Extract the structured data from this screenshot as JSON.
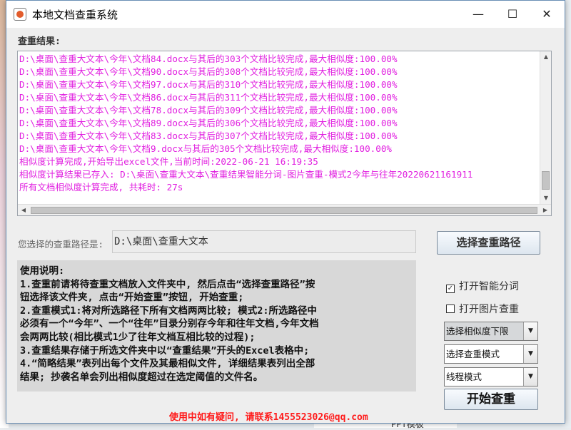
{
  "window": {
    "title": "本地文档查重系统",
    "minimize": "—",
    "maximize": "☐",
    "close": "✕"
  },
  "results": {
    "label": "查重结果:",
    "lines": [
      "D:\\桌面\\查重大文本\\今年\\文档84.docx与其后的303个文档比较完成,最大相似度:100.00%",
      "D:\\桌面\\查重大文本\\今年\\文档90.docx与其后的308个文档比较完成,最大相似度:100.00%",
      "D:\\桌面\\查重大文本\\今年\\文档97.docx与其后的310个文档比较完成,最大相似度:100.00%",
      "D:\\桌面\\查重大文本\\今年\\文档86.docx与其后的311个文档比较完成,最大相似度:100.00%",
      "D:\\桌面\\查重大文本\\今年\\文档78.docx与其后的309个文档比较完成,最大相似度:100.00%",
      "D:\\桌面\\查重大文本\\今年\\文档89.docx与其后的306个文档比较完成,最大相似度:100.00%",
      "D:\\桌面\\查重大文本\\今年\\文档83.docx与其后的307个文档比较完成,最大相似度:100.00%",
      "D:\\桌面\\查重大文本\\今年\\文档9.docx与其后的305个文档比较完成,最大相似度:100.00%",
      "相似度计算完成,开始导出excel文件,当前时间:2022-06-21 16:19:35",
      "相似度计算结果已存入: D:\\桌面\\查重大文本\\查重结果智能分词-图片查重-模式2今年与往年20220621161911",
      "所有文档相似度计算完成, 共耗时: 27s"
    ]
  },
  "path": {
    "label": "您选择的查重路径是:",
    "value": "D:\\桌面\\查重大文本",
    "choose_button": "选择查重路径"
  },
  "help": {
    "title": "使用说明:",
    "lines": [
      "  1.查重前请将待查重文档放入文件夹中, 然后点击“选择查重路径”按",
      "钮选择该文件夹, 点击“开始查重”按钮, 开始查重;",
      "  2.查重模式1:将对所选路径下所有文档两两比较;  模式2:所选路径中",
      "必须有一个“今年”、一个“往年”目录分别存今年和往年文档,今年文档",
      "会两两比较(相比模式1少了往年文档互相比较的过程);",
      "  3.查重结果存储于所选文件夹中以“查重结果”开头的Excel表格中;",
      "  4.“简略结果”表列出每个文件及其最相似文件, 详细结果表列出全部",
      "结果; 抄袭名单会列出相似度超过在选定阈值的文件名。"
    ]
  },
  "options": {
    "smart_segmentation": {
      "label": "打开智能分词",
      "checked": true
    },
    "image_check": {
      "label": "打开图片查重",
      "checked": false
    },
    "similarity_threshold": "选择相似度下限",
    "check_mode": "选择查重模式",
    "thread_mode": "线程模式",
    "start_button": "开始查重"
  },
  "footer": "使用中如有疑问, 请联系1455523026@qq.com",
  "background": {
    "taskbar_text": "PPT模板"
  }
}
